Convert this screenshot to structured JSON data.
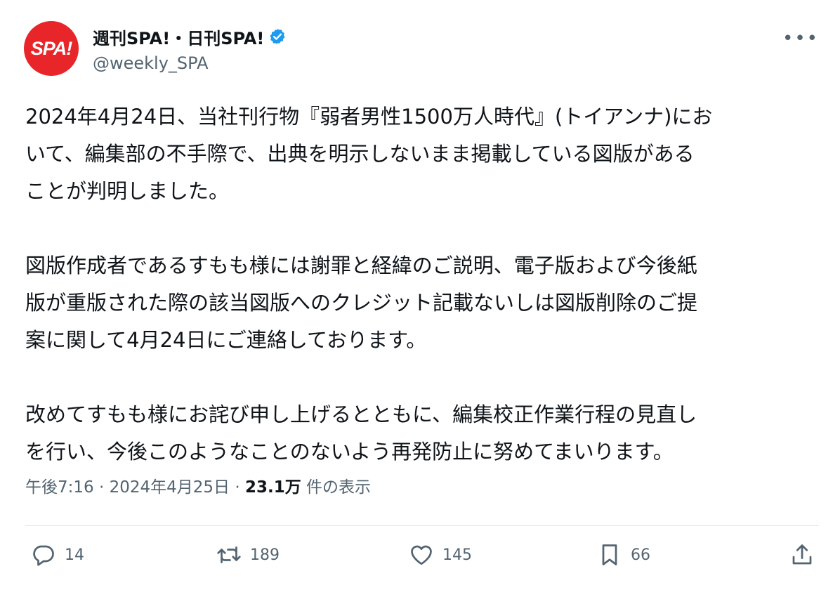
{
  "account": {
    "avatar_text": "SPA!",
    "display_name": "週刊SPA!・日刊SPA!",
    "handle": "@weekly_SPA",
    "brand_color": "#e8262a",
    "verified_color": "#1d9bf0"
  },
  "tweet": {
    "paragraphs": [
      "2024年4月24日、当社刊行物『弱者男性1500万人時代』(トイアンナ)にお\nいて、編集部の不手際で、出典を明示しないまま掲載している図版がある\nことが判明しました。",
      "図版作成者であるすもも様には謝罪と経緯のご説明、電子版および今後紙\n版が重版された際の該当図版へのクレジット記載ないしは図版削除のご提\n案に関して4月24日にご連絡しております。",
      "改めてすもも様にお詫び申し上げるとともに、編集校正作業行程の見直し\nを行い、今後このようなことのないよう再発防止に努めてまいります。"
    ],
    "time": "午後7:16",
    "separator": "·",
    "date": "2024年4月25日",
    "views_count": "23.1万",
    "views_label": "件の表示"
  },
  "actions": {
    "reply_count": "14",
    "retweet_count": "189",
    "like_count": "145",
    "bookmark_count": "66",
    "icons": [
      "reply-icon",
      "retweet-icon",
      "like-icon",
      "bookmark-icon",
      "share-icon"
    ]
  }
}
